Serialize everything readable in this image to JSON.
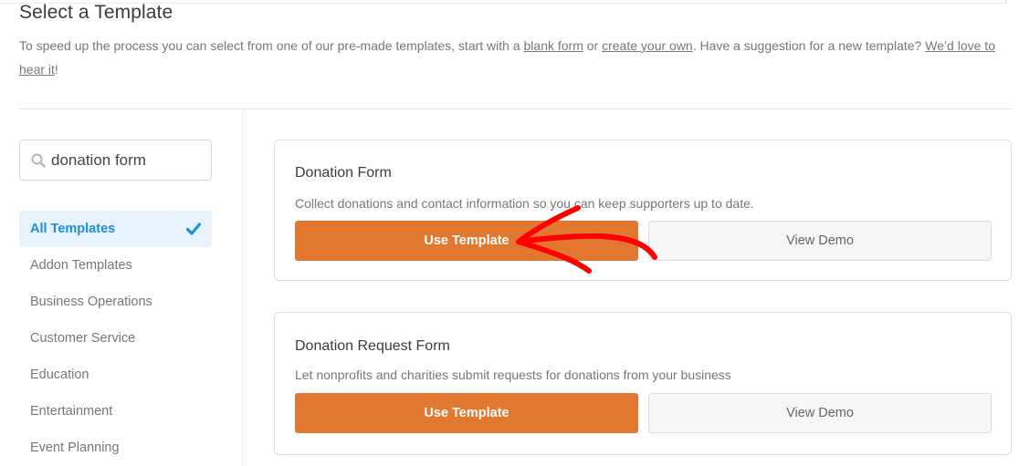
{
  "header": {
    "title": "Select a Template",
    "intro_part1": "To speed up the process you can select from one of our pre-made templates, start with a ",
    "link_blank_form": "blank form",
    "intro_or": " or ",
    "link_create_own": "create your own",
    "intro_part2": ". Have a suggestion for a new template? ",
    "link_suggest": "We’d love to hear it",
    "intro_end": "!"
  },
  "search": {
    "value": "donation form",
    "icon": "search-icon"
  },
  "categories": [
    {
      "label": "All Templates",
      "active": true,
      "icon": "check-icon"
    },
    {
      "label": "Addon Templates"
    },
    {
      "label": "Business Operations"
    },
    {
      "label": "Customer Service"
    },
    {
      "label": "Education"
    },
    {
      "label": "Entertainment"
    },
    {
      "label": "Event Planning"
    }
  ],
  "templates": [
    {
      "title": "Donation Form",
      "description": "Collect donations and contact information so you can keep supporters up to date.",
      "use_label": "Use Template",
      "demo_label": "View Demo"
    },
    {
      "title": "Donation Request Form",
      "description": "Let nonprofits and charities submit requests for donations from your business",
      "use_label": "Use Template",
      "demo_label": "View Demo"
    }
  ],
  "colors": {
    "accent_orange": "#e27730",
    "active_blue": "#1e90d8",
    "active_bg": "#e8f2fb",
    "annotation_red": "#ff0000"
  },
  "annotation": {
    "type": "hand-drawn-arrow",
    "points_to": "Donation Form Use Template button"
  }
}
